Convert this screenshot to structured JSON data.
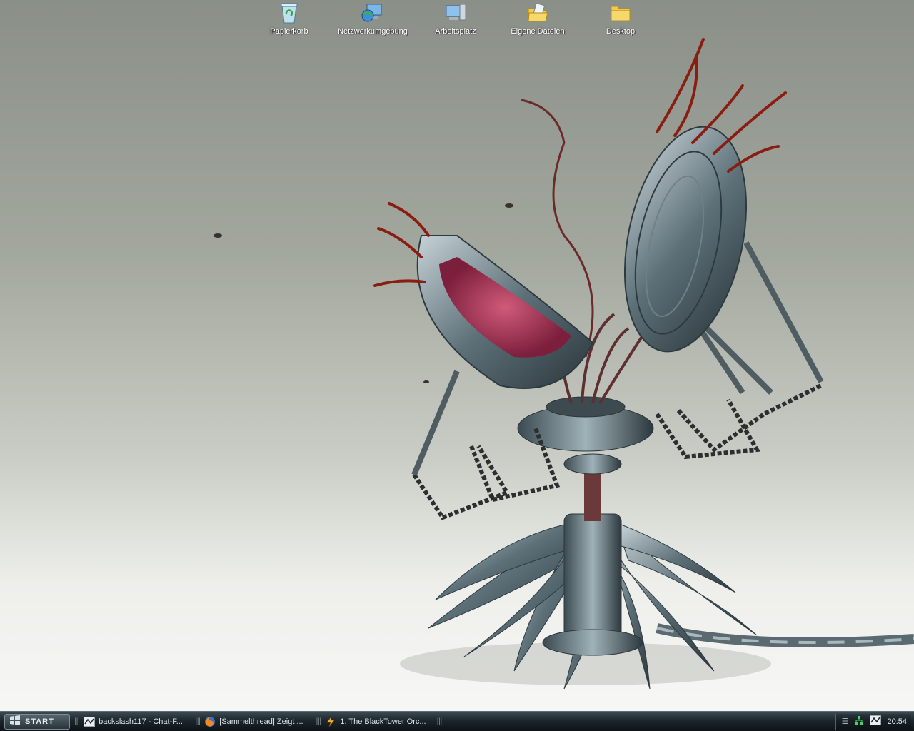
{
  "desktop": {
    "icons": [
      {
        "label": "Papierkorb",
        "icon": "recycle-bin-icon"
      },
      {
        "label": "Netzwerkumgebung",
        "icon": "network-icon"
      },
      {
        "label": "Arbeitsplatz",
        "icon": "computer-icon"
      },
      {
        "label": "Eigene Dateien",
        "icon": "documents-folder-icon"
      },
      {
        "label": "Desktop",
        "icon": "folder-icon"
      }
    ]
  },
  "taskbar": {
    "start_label": "START",
    "tasks": [
      {
        "label": "backslash117 - Chat-F...",
        "icon": "chat-window-icon"
      },
      {
        "label": "[Sammelthread] Zeigt ...",
        "icon": "firefox-icon"
      },
      {
        "label": "1. The BlackTower Orc...",
        "icon": "winamp-icon"
      }
    ],
    "tray": {
      "clock": "20:54",
      "icons": [
        "network-tray-icon",
        "app-tray-icon"
      ]
    }
  },
  "colors": {
    "taskbar_bg": "#1d262c",
    "accent_green": "#3fd66a",
    "wallpaper_top": "#8a8f88",
    "wallpaper_bottom": "#f8f8f6"
  }
}
